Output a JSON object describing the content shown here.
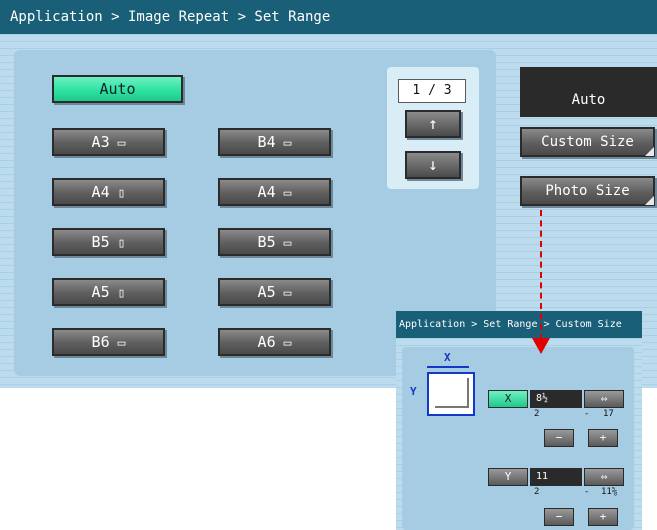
{
  "title_bar": {
    "breadcrumb": "Application > Image Repeat > Set Range"
  },
  "paper_sizes": {
    "auto_label": "Auto",
    "items": [
      {
        "label": "A3",
        "orientation": "landscape"
      },
      {
        "label": "B4",
        "orientation": "landscape"
      },
      {
        "label": "A4",
        "orientation": "portrait"
      },
      {
        "label": "A4",
        "orientation": "landscape"
      },
      {
        "label": "B5",
        "orientation": "portrait"
      },
      {
        "label": "B5",
        "orientation": "landscape"
      },
      {
        "label": "A5",
        "orientation": "portrait"
      },
      {
        "label": "A5",
        "orientation": "landscape"
      },
      {
        "label": "B6",
        "orientation": "landscape"
      },
      {
        "label": "A6",
        "orientation": "landscape"
      }
    ]
  },
  "pager": {
    "indicator": "1 / 3",
    "up_icon": "↑",
    "down_icon": "↓"
  },
  "right_panel": {
    "auto_label": "Auto",
    "custom_size_label": "Custom Size",
    "photo_size_label": "Photo Size"
  },
  "inset": {
    "breadcrumb": "Application > Set Range > Custom Size",
    "x_axis_label": "X",
    "y_axis_label": "Y",
    "x_button": "X",
    "x_value": "8½",
    "x_min": "2",
    "x_max": "17",
    "y_button": "Y",
    "y_value": "11",
    "y_min": "2",
    "y_max": "11⅝",
    "swap_icon": "⇔",
    "minus_icon": "−",
    "plus_icon": "+"
  },
  "colors": {
    "title_bar": "#1a5f78",
    "accent_green": "#2ee3a2",
    "annotation_red": "#e00000"
  }
}
